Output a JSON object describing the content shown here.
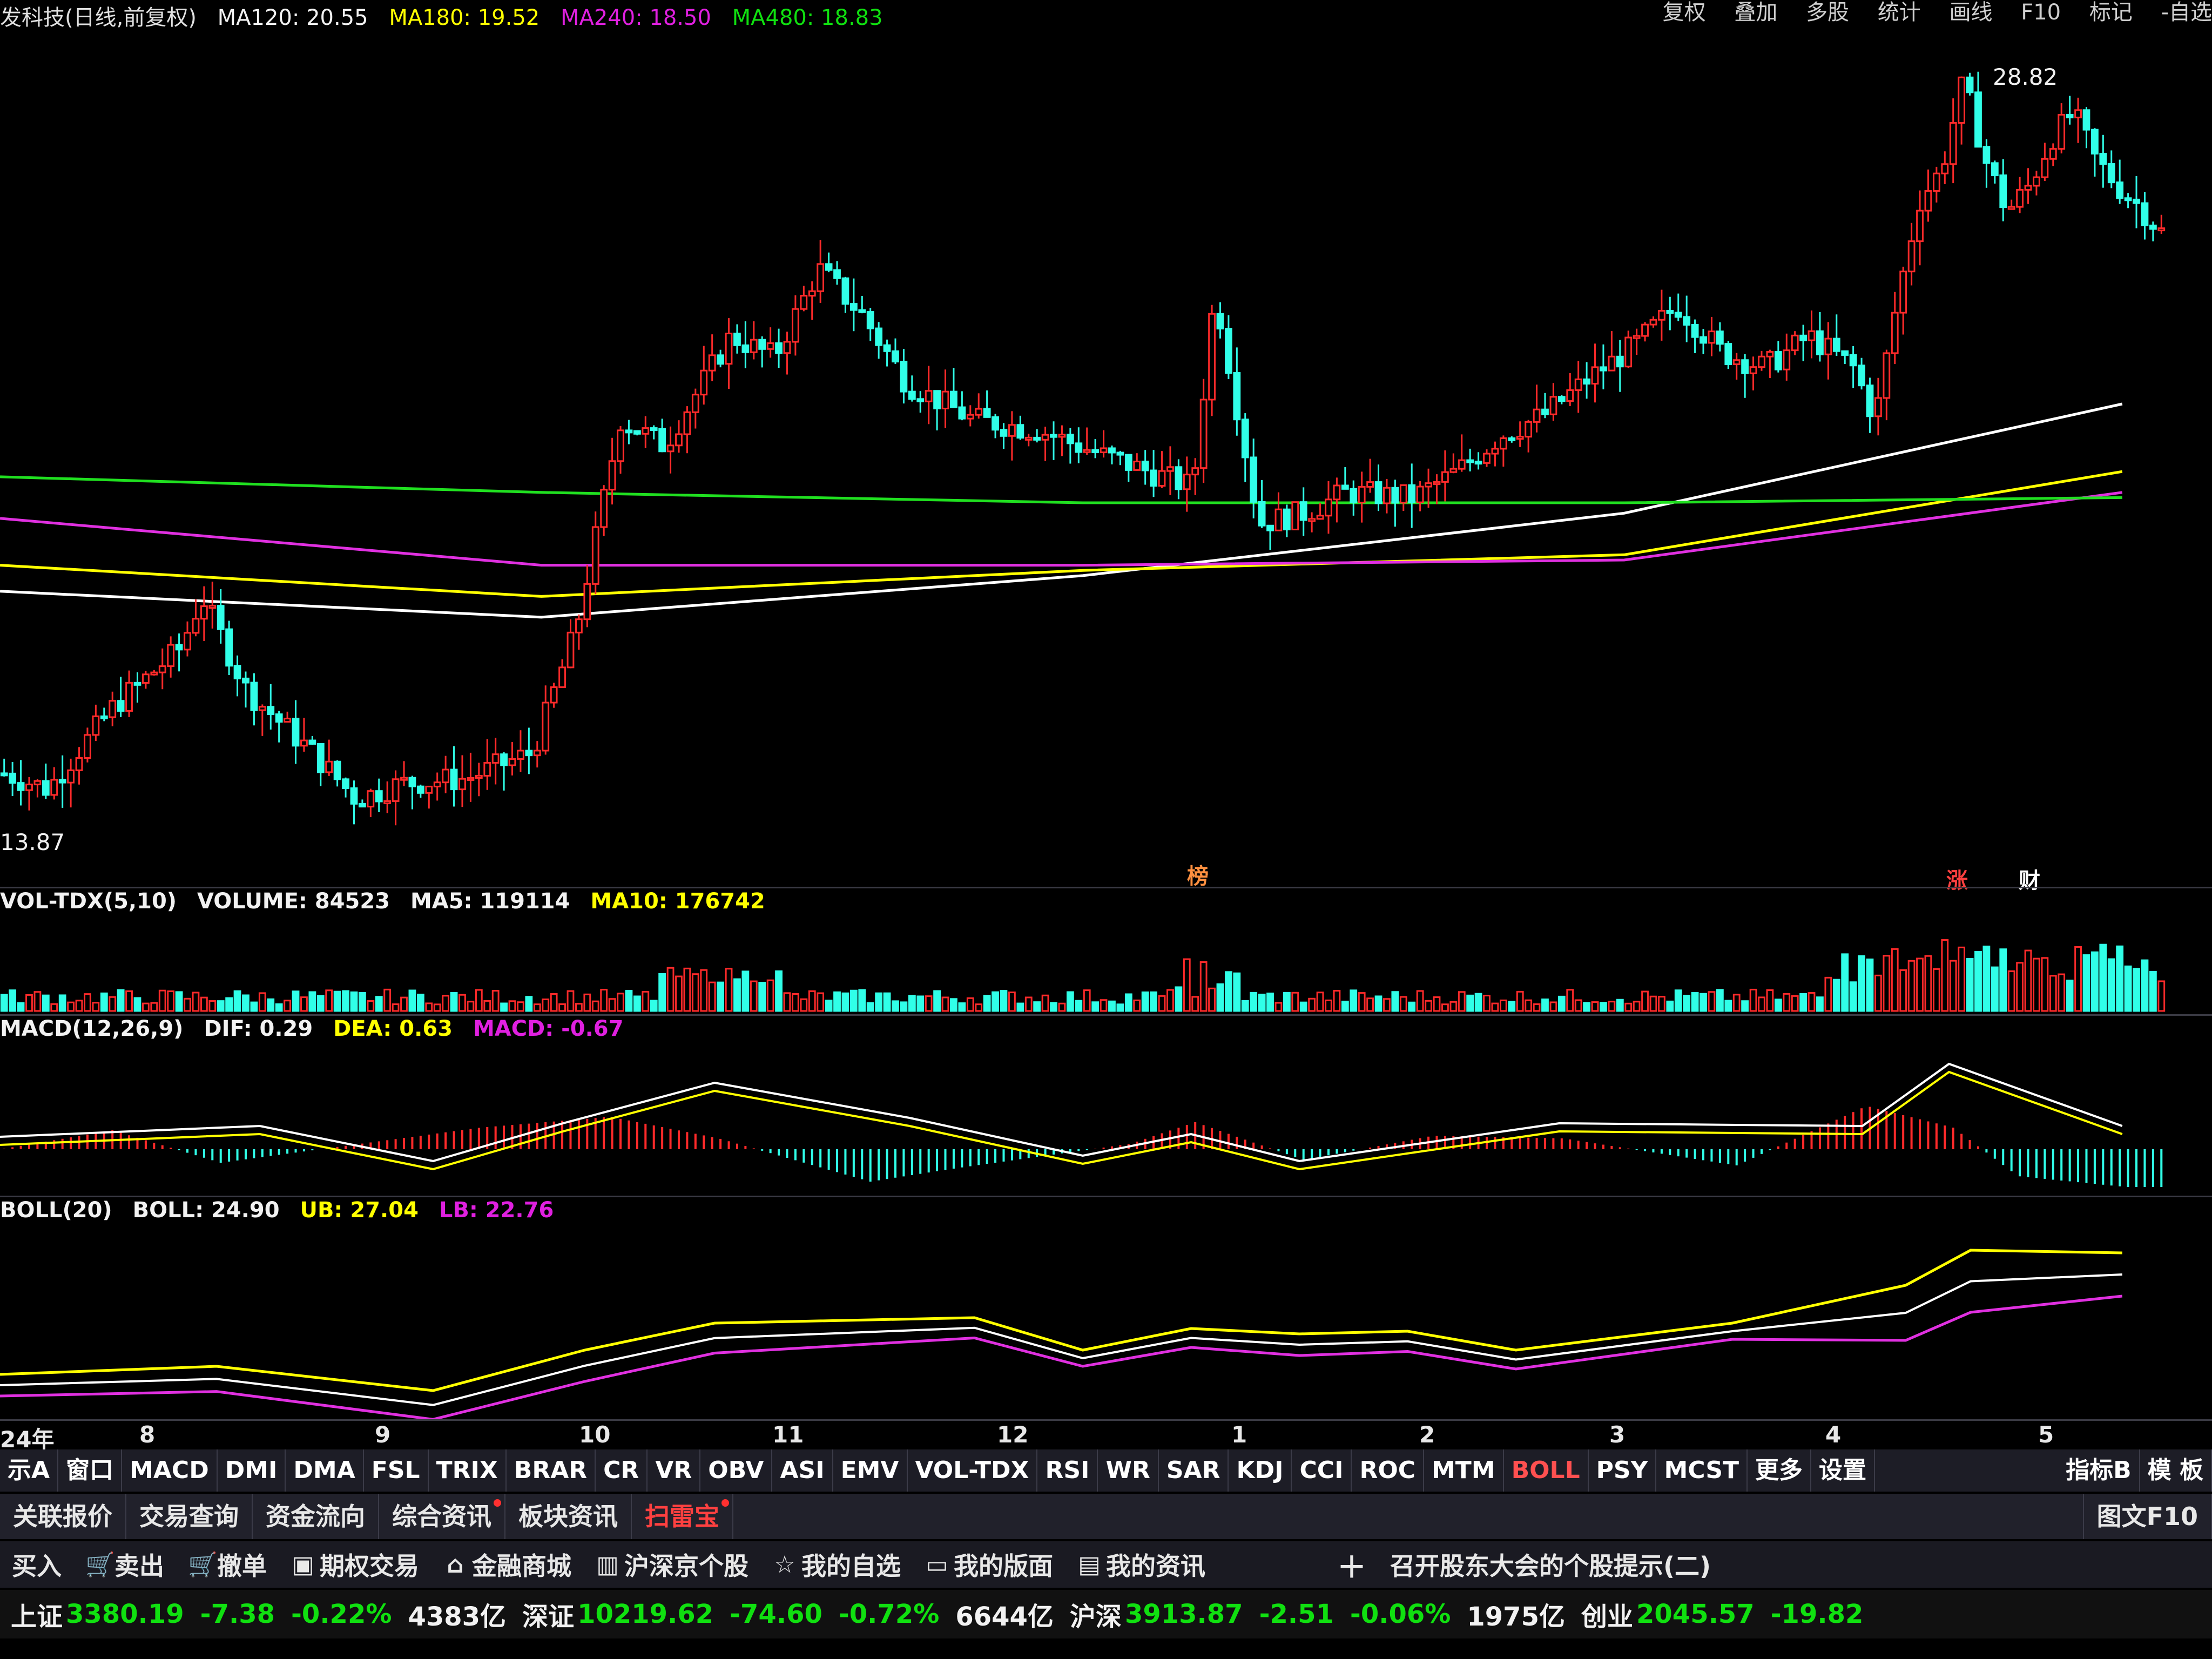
{
  "header": {
    "title": "发科技(日线,前复权)",
    "ma120": "MA120: 20.55",
    "ma180": "MA180: 19.52",
    "ma240": "MA240: 18.50",
    "ma480": "MA480: 18.83",
    "right_menu": [
      "复权",
      "叠加",
      "多股",
      "统计",
      "画线",
      "F10",
      "标记",
      "-自选"
    ]
  },
  "price_panel": {
    "high_label": "28.82",
    "low_label": "13.87",
    "event_markers": [
      "榜",
      "涨",
      "财"
    ]
  },
  "volume_panel": {
    "name": "VOL-TDX(5,10)",
    "volume": "VOLUME: 84523",
    "ma5": "MA5: 119114",
    "ma10": "MA10: 176742"
  },
  "macd_panel": {
    "name": "MACD(12,26,9)",
    "dif": "DIF: 0.29",
    "dea": "DEA: 0.63",
    "macd": "MACD: -0.67"
  },
  "boll_panel": {
    "name": "BOLL(20)",
    "boll": "BOLL: 24.90",
    "ub": "UB: 27.04",
    "lb": "LB: 22.76"
  },
  "time_axis": [
    "24年",
    "8",
    "9",
    "10",
    "11",
    "12",
    "1",
    "2",
    "3",
    "4",
    "5"
  ],
  "indicator_tabs": [
    "示A",
    "窗口",
    "MACD",
    "DMI",
    "DMA",
    "FSL",
    "TRIX",
    "BRAR",
    "CR",
    "VR",
    "OBV",
    "ASI",
    "EMV",
    "VOL-TDX",
    "RSI",
    "WR",
    "SAR",
    "KDJ",
    "CCI",
    "ROC",
    "MTM",
    "BOLL",
    "PSY",
    "MCST",
    "更多",
    "设置"
  ],
  "indicator_active": "BOLL",
  "indicator_right": [
    "指标B",
    "模 板"
  ],
  "info_tabs": [
    "关联报价",
    "交易查询",
    "资金流向",
    "综合资讯",
    "板块资讯",
    "扫雷宝"
  ],
  "info_right": "图文F10",
  "trade_bar": {
    "items": [
      "买入",
      "卖出",
      "撤单",
      "期权交易",
      "金融商城",
      "沪深京个股",
      "我的自选",
      "我的版面",
      "我的资讯"
    ],
    "notice": "召开股东大会的个股提示(二)"
  },
  "status_bar": {
    "sh_name": "上证",
    "sh_val": "3380.19",
    "sh_chg": "-7.38",
    "sh_pct": "-0.22%",
    "sh_amt": "4383亿",
    "sz_name": "深证",
    "sz_val": "10219.62",
    "sz_chg": "-74.60",
    "sz_pct": "-0.72%",
    "sz_amt": "6644亿",
    "hs_name": "沪深",
    "hs_val": "3913.87",
    "hs_chg": "-2.51",
    "hs_pct": "-0.06%",
    "hs_amt": "1975亿",
    "cy_name": "创业",
    "cy_val": "2045.57",
    "cy_chg": "-19.82"
  },
  "colors": {
    "up": "#ff2a2a",
    "down": "#30ffe8",
    "ma120": "#ffffff",
    "ma180": "#ffff00",
    "ma240": "#e030e0",
    "ma480": "#20e020",
    "background": "#000000"
  },
  "chart_data": {
    "type": "line",
    "y_range": [
      13.87,
      28.82
    ],
    "close_points": [
      [
        0,
        15.2
      ],
      [
        0.02,
        14.9
      ],
      [
        0.05,
        16.5
      ],
      [
        0.08,
        17.6
      ],
      [
        0.09,
        18.6
      ],
      [
        0.11,
        16.8
      ],
      [
        0.14,
        15.6
      ],
      [
        0.16,
        14.7
      ],
      [
        0.18,
        15.0
      ],
      [
        0.21,
        15.1
      ],
      [
        0.24,
        15.6
      ],
      [
        0.26,
        18.0
      ],
      [
        0.28,
        22.0
      ],
      [
        0.3,
        21.5
      ],
      [
        0.33,
        23.6
      ],
      [
        0.35,
        23.2
      ],
      [
        0.37,
        24.9
      ],
      [
        0.39,
        24.0
      ],
      [
        0.41,
        22.7
      ],
      [
        0.44,
        22.0
      ],
      [
        0.47,
        21.8
      ],
      [
        0.5,
        21.3
      ],
      [
        0.52,
        21.0
      ],
      [
        0.54,
        20.7
      ],
      [
        0.55,
        24.5
      ],
      [
        0.57,
        20.0
      ],
      [
        0.59,
        20.2
      ],
      [
        0.61,
        20.6
      ],
      [
        0.64,
        20.5
      ],
      [
        0.66,
        21.0
      ],
      [
        0.68,
        21.7
      ],
      [
        0.7,
        22.1
      ],
      [
        0.72,
        22.8
      ],
      [
        0.74,
        23.4
      ],
      [
        0.76,
        24.2
      ],
      [
        0.78,
        23.3
      ],
      [
        0.8,
        23.0
      ],
      [
        0.82,
        23.6
      ],
      [
        0.84,
        23.0
      ],
      [
        0.85,
        22.0
      ],
      [
        0.86,
        24.3
      ],
      [
        0.87,
        26.2
      ],
      [
        0.88,
        26.8
      ],
      [
        0.89,
        28.5
      ],
      [
        0.9,
        27.0
      ],
      [
        0.91,
        26.0
      ],
      [
        0.92,
        26.5
      ],
      [
        0.93,
        27.4
      ],
      [
        0.94,
        27.9
      ],
      [
        0.95,
        27.0
      ],
      [
        0.96,
        26.5
      ],
      [
        0.97,
        26.1
      ],
      [
        0.98,
        25.6
      ]
    ],
    "ma_series": [
      {
        "name": "MA120",
        "values": [
          [
            0,
            18.7
          ],
          [
            0.25,
            18.2
          ],
          [
            0.5,
            19.0
          ],
          [
            0.75,
            20.2
          ],
          [
            0.98,
            22.3
          ]
        ]
      },
      {
        "name": "MA180",
        "values": [
          [
            0,
            19.2
          ],
          [
            0.25,
            18.6
          ],
          [
            0.5,
            19.1
          ],
          [
            0.75,
            19.4
          ],
          [
            0.98,
            21.0
          ]
        ]
      },
      {
        "name": "MA240",
        "values": [
          [
            0,
            20.1
          ],
          [
            0.25,
            19.2
          ],
          [
            0.5,
            19.2
          ],
          [
            0.75,
            19.3
          ],
          [
            0.98,
            20.6
          ]
        ]
      },
      {
        "name": "MA480",
        "values": [
          [
            0,
            20.9
          ],
          [
            0.25,
            20.6
          ],
          [
            0.5,
            20.4
          ],
          [
            0.75,
            20.4
          ],
          [
            0.98,
            20.5
          ]
        ]
      }
    ]
  }
}
